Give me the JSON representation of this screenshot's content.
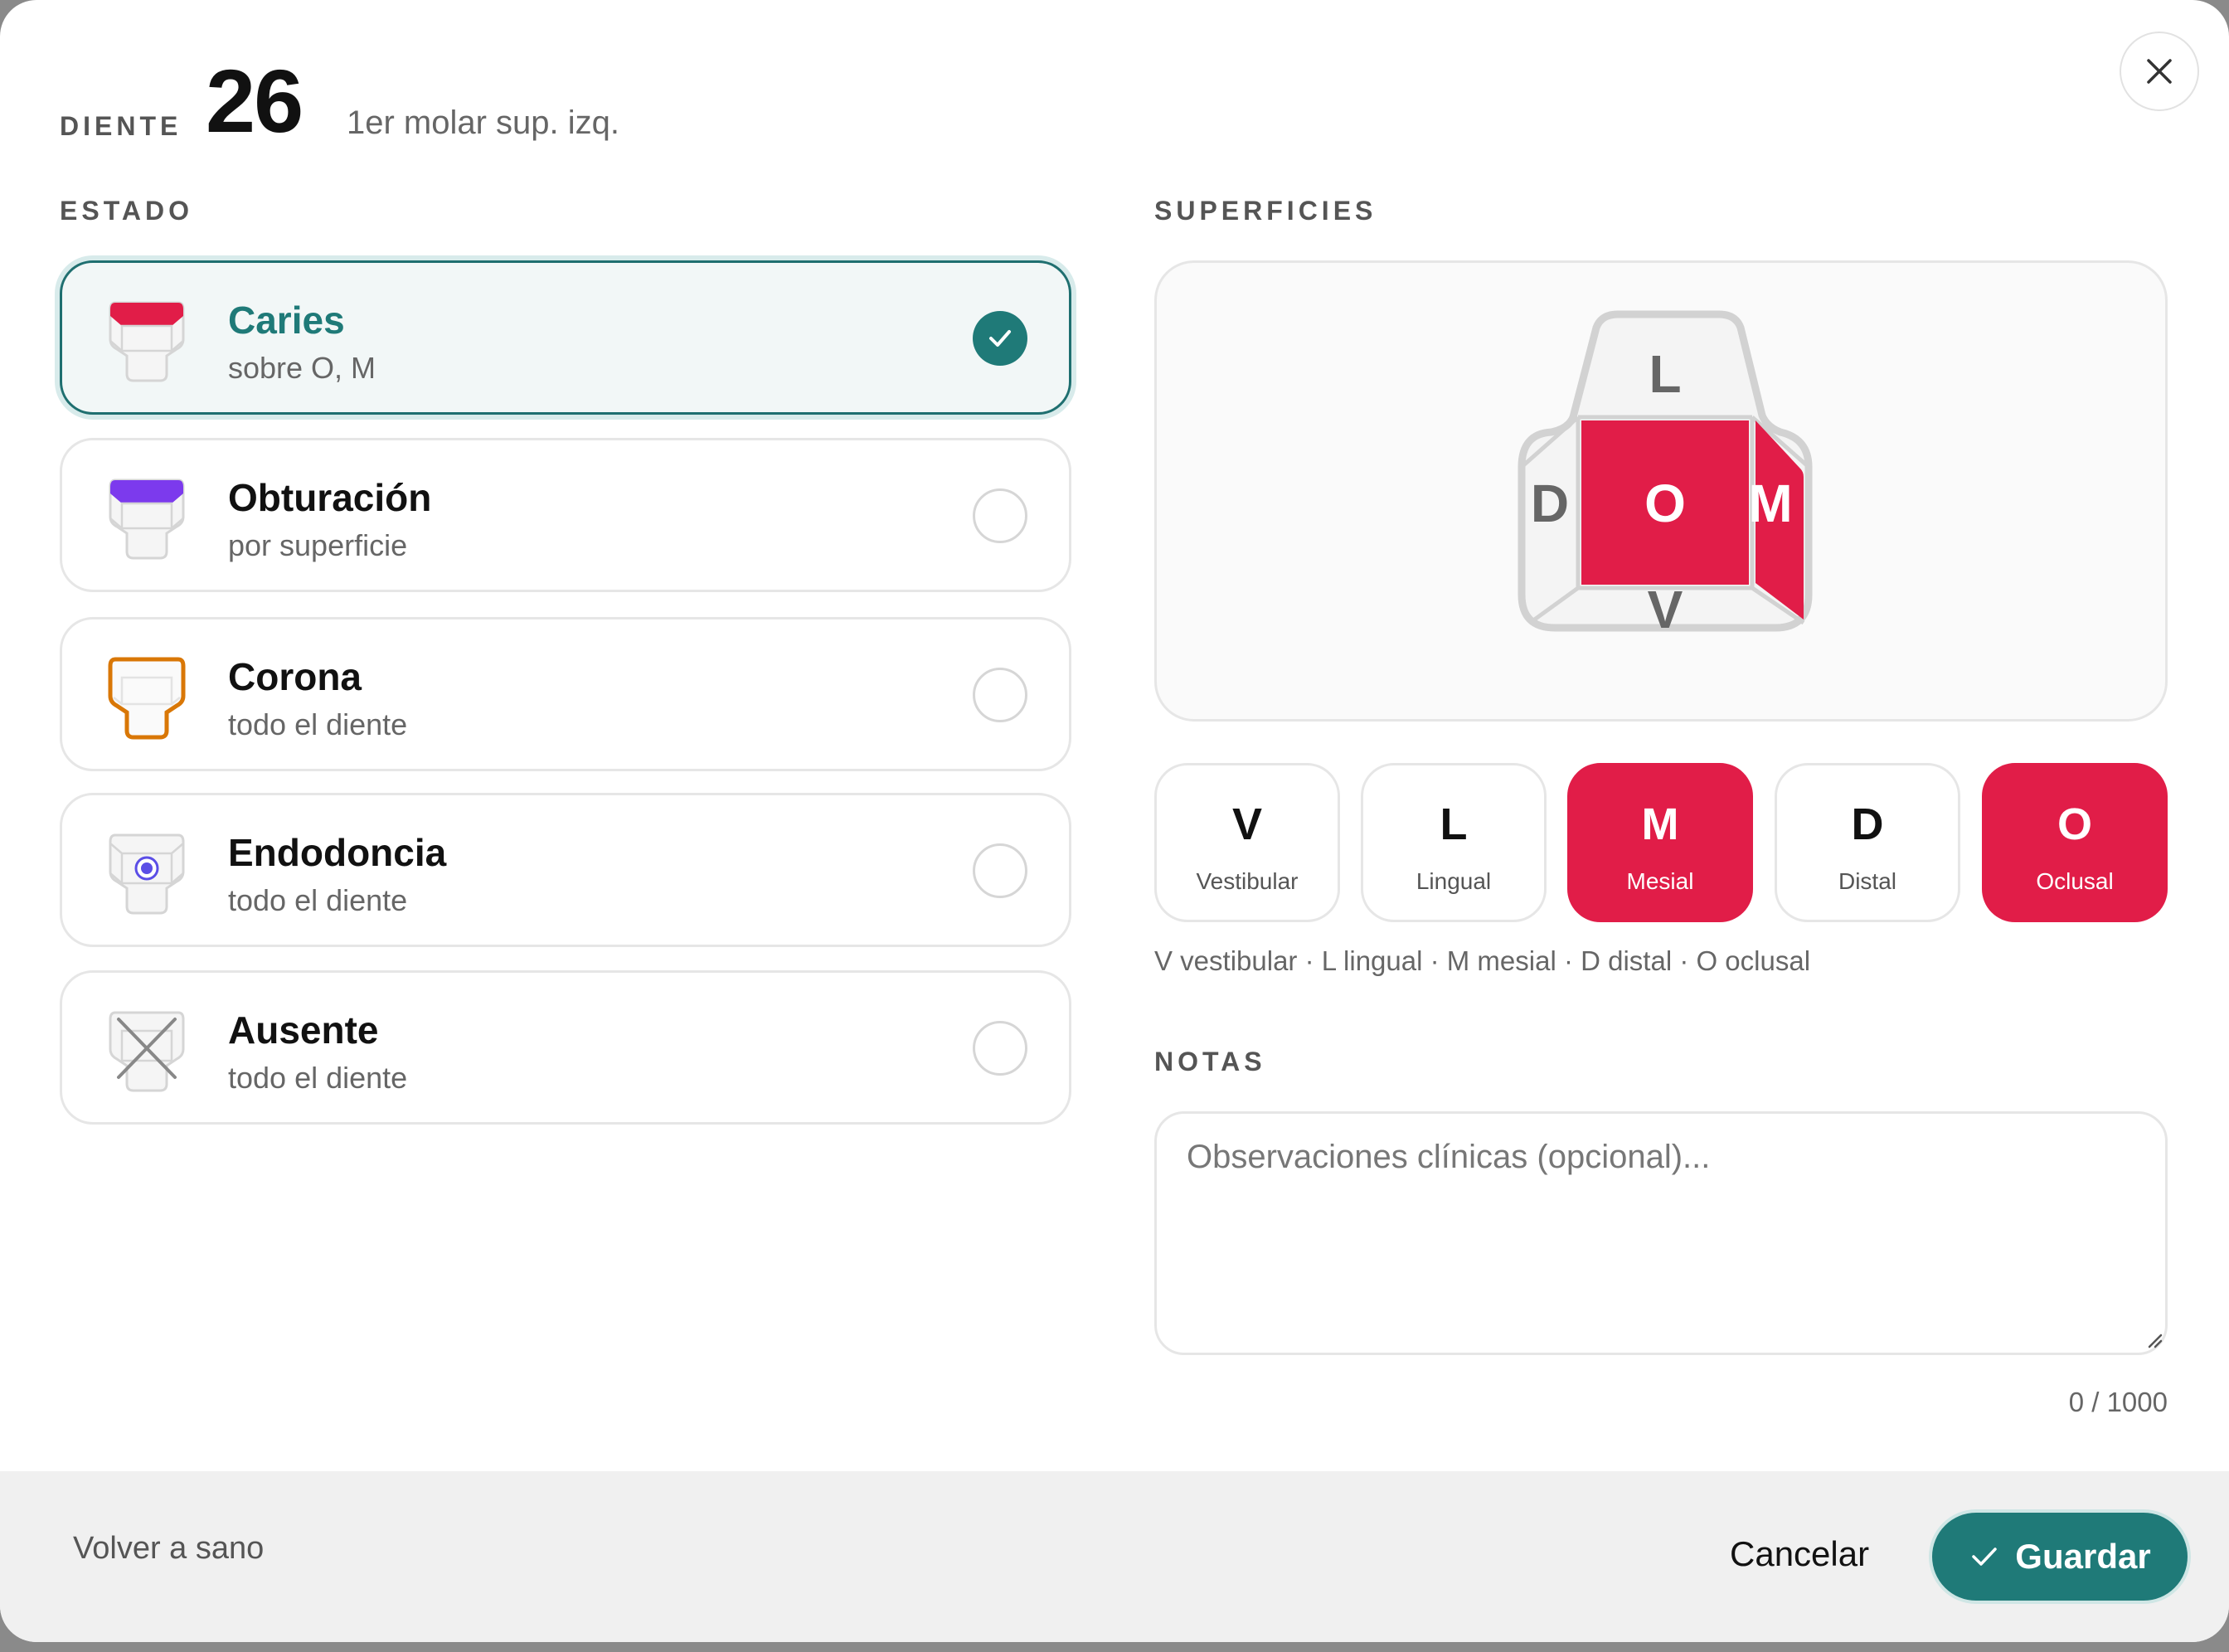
{
  "header": {
    "label": "DIENTE",
    "tooth_number": "26",
    "tooth_name": "1er molar sup. izq."
  },
  "estado": {
    "title": "ESTADO",
    "options": [
      {
        "label": "Caries",
        "sub": "sobre O, M",
        "selected": true,
        "color": "#e11d48",
        "icon": "caries-tooth-icon"
      },
      {
        "label": "Obturación",
        "sub": "por superficie",
        "selected": false,
        "color": "#7c3aed",
        "icon": "filling-tooth-icon"
      },
      {
        "label": "Corona",
        "sub": "todo el diente",
        "selected": false,
        "color": "#d97706",
        "icon": "crown-tooth-icon"
      },
      {
        "label": "Endodoncia",
        "sub": "todo el diente",
        "selected": false,
        "color": "#5b4ee6",
        "icon": "root-canal-tooth-icon"
      },
      {
        "label": "Ausente",
        "sub": "todo el diente",
        "selected": false,
        "color": "#777777",
        "icon": "missing-tooth-icon"
      }
    ]
  },
  "superficies": {
    "title": "SUPERFICIES",
    "diagram": {
      "top": "L",
      "left": "D",
      "center": "O",
      "right": "M",
      "bottom": "V"
    },
    "buttons": [
      {
        "letter": "V",
        "name": "Vestibular",
        "active": false
      },
      {
        "letter": "L",
        "name": "Lingual",
        "active": false
      },
      {
        "letter": "M",
        "name": "Mesial",
        "active": true
      },
      {
        "letter": "D",
        "name": "Distal",
        "active": false
      },
      {
        "letter": "O",
        "name": "Oclusal",
        "active": true
      }
    ],
    "legend": "V vestibular · L lingual · M mesial · D distal · O oclusal"
  },
  "notas": {
    "title": "NOTAS",
    "placeholder": "Observaciones clínicas (opcional)...",
    "value": "",
    "counter": "0 / 1000"
  },
  "footer": {
    "reset": "Volver a sano",
    "cancel": "Cancelar",
    "save": "Guardar"
  },
  "colors": {
    "accent": "#1f7a78",
    "caries": "#e11d48"
  }
}
